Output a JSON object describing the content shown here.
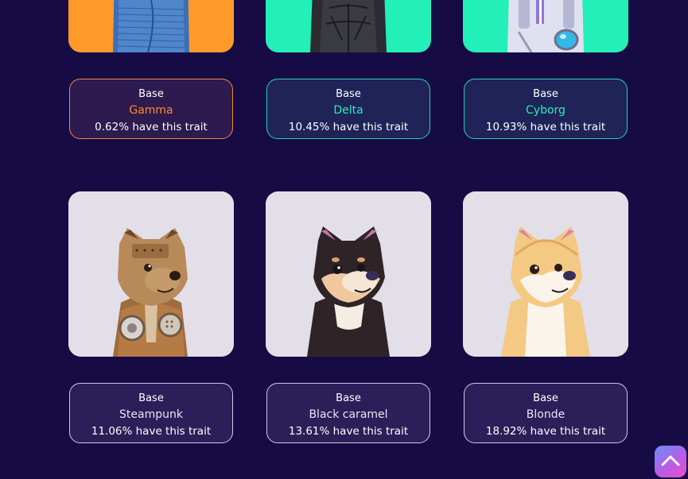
{
  "cards_top": [
    {
      "trait_type": "Base",
      "value": "Gamma",
      "pct": "0.62% have this trait",
      "value_color": "#ff8c2e",
      "border_color": "#f08a3a",
      "bg_color": "#2d1a4e"
    },
    {
      "trait_type": "Base",
      "value": "Delta",
      "pct": "10.45% have this trait",
      "value_color": "#22f2b5",
      "border_color": "#22d6ad",
      "bg_color": "#1f2358"
    },
    {
      "trait_type": "Base",
      "value": "Cyborg",
      "pct": "10.93% have this trait",
      "value_color": "#22f2b5",
      "border_color": "#22d6ad",
      "bg_color": "#1f2358"
    }
  ],
  "cards_bottom": [
    {
      "trait_type": "Base",
      "value": "Steampunk",
      "pct": "11.06% have this trait",
      "value_color": "#e8e4f5",
      "border_color": "#cfc8e6",
      "bg_color": "#2c1e58"
    },
    {
      "trait_type": "Base",
      "value": "Black caramel",
      "pct": "13.61% have this trait",
      "value_color": "#e8e4f5",
      "border_color": "#cfc8e6",
      "bg_color": "#2c1e58"
    },
    {
      "trait_type": "Base",
      "value": "Blonde",
      "pct": "18.92% have this trait",
      "value_color": "#e8e4f5",
      "border_color": "#cfc8e6",
      "bg_color": "#2c1e58"
    }
  ],
  "images": [
    {
      "name": "gamma",
      "bg": "#ff9a2a"
    },
    {
      "name": "delta",
      "bg": "#22f0b6"
    },
    {
      "name": "cyborg",
      "bg": "#22f0b6"
    },
    {
      "name": "steampunk",
      "bg": "#e2dfe8"
    },
    {
      "name": "black-caramel",
      "bg": "#e2dfe8"
    },
    {
      "name": "blonde",
      "bg": "#e2dfe8"
    }
  ],
  "scroll_top": {
    "icon": "chevron-up-icon"
  }
}
